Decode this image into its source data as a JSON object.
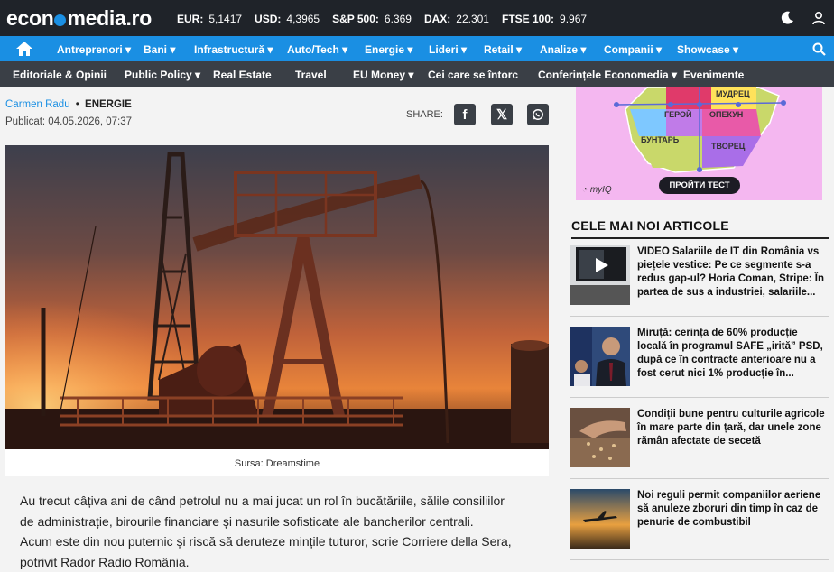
{
  "header": {
    "logo": "economedia.ro",
    "tickers": [
      {
        "label": "EUR:",
        "value": "5,1417"
      },
      {
        "label": "USD:",
        "value": "4,3965"
      },
      {
        "label": "S&P 500:",
        "value": "6.369"
      },
      {
        "label": "DAX:",
        "value": "22.301"
      },
      {
        "label": "FTSE 100:",
        "value": "9.967"
      }
    ],
    "icons": {
      "theme": "moon-icon",
      "account": "user-icon",
      "home": "home-icon",
      "search": "search-icon"
    }
  },
  "nav_primary": [
    "Antreprenori ▾",
    "Bani ▾",
    "Infrastructură ▾",
    "Auto/Tech ▾",
    "Energie ▾",
    "Lideri ▾",
    "Retail ▾",
    "Analize ▾",
    "Companii ▾",
    "Showcase ▾"
  ],
  "nav_secondary": [
    "Editoriale & Opinii",
    "Public Policy ▾",
    "Real Estate",
    "Travel",
    "EU Money ▾",
    "Cei care se întorc",
    "Conferințele Economedia ▾",
    "Evenimente"
  ],
  "article": {
    "author": "Carmen Radu",
    "bullet": "•",
    "category": "ENERGIE",
    "published": "Publicat: 04.05.2026, 07:37",
    "share_label": "SHARE:",
    "share_buttons": [
      "f",
      "𝕏",
      "W"
    ],
    "image_caption": "Sursa: Dreamstime",
    "body": [
      "Au trecut câțiva ani de când petrolul nu a mai jucat un rol în bucătăriile, sălile consiliilor",
      "de administrație, birourile financiare și nasurile sofisticate ale bancherilor centrali.",
      "Acum este din nou puternic și riscă să deruteze mințile tuturor, scrie Corriere della Sera,",
      "potrivit Rador Radio România."
    ]
  },
  "ad": {
    "labels": [
      "МУДРЕЦ",
      "ГЕРОЙ",
      "ОПЕКУН",
      "БУНТАРЬ",
      "ТВОРЕЦ"
    ],
    "cta": "ПРОЙТИ ТЕСТ",
    "brand": "myIQ"
  },
  "sidebar": {
    "title": "CELE MAI NOI ARTICOLE",
    "articles": [
      {
        "title": "VIDEO Salariile de IT din România vs piețele vestice: Pe ce segmente s-a redus gap-ul? Horia Coman, Stripe: În partea de sus a industriei, salariile..."
      },
      {
        "title": "Miruță: cerința de 60% producție locală în programul SAFE „irită” PSD, după ce în contracte anterioare nu a fost cerut nici 1% producție în..."
      },
      {
        "title": "Condiții bune pentru culturile agricole în mare parte din țară, dar unele zone rămân afectate de secetă"
      },
      {
        "title": "Noi reguli permit companiilor aeriene să anuleze zboruri din timp în caz de penurie de combustibil"
      }
    ]
  },
  "colors": {
    "accent": "#1a8fe3",
    "topbar": "#1f2329",
    "nav2": "#3a3f46",
    "ad_bg": "#f4b7f0"
  }
}
